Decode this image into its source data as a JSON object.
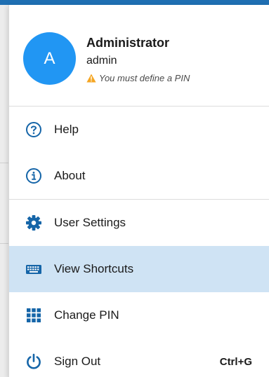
{
  "user": {
    "avatar_letter": "A",
    "name": "Administrator",
    "login": "admin",
    "warning": "You must define a PIN"
  },
  "menu": {
    "help_label": "Help",
    "about_label": "About",
    "user_settings_label": "User Settings",
    "view_shortcuts_label": "View Shortcuts",
    "change_pin_label": "Change PIN",
    "sign_out_label": "Sign Out",
    "sign_out_shortcut": "Ctrl+G"
  },
  "icons": {
    "help": "help-circle-icon",
    "about": "info-circle-icon",
    "user_settings": "gear-icon",
    "view_shortcuts": "keyboard-icon",
    "change_pin": "keypad-grid-icon",
    "sign_out": "power-icon",
    "warning": "warning-triangle-icon"
  },
  "colors": {
    "accent": "#2196f3",
    "icon": "#1565a8",
    "highlight": "#cfe3f4",
    "warning": "#f5a623"
  }
}
